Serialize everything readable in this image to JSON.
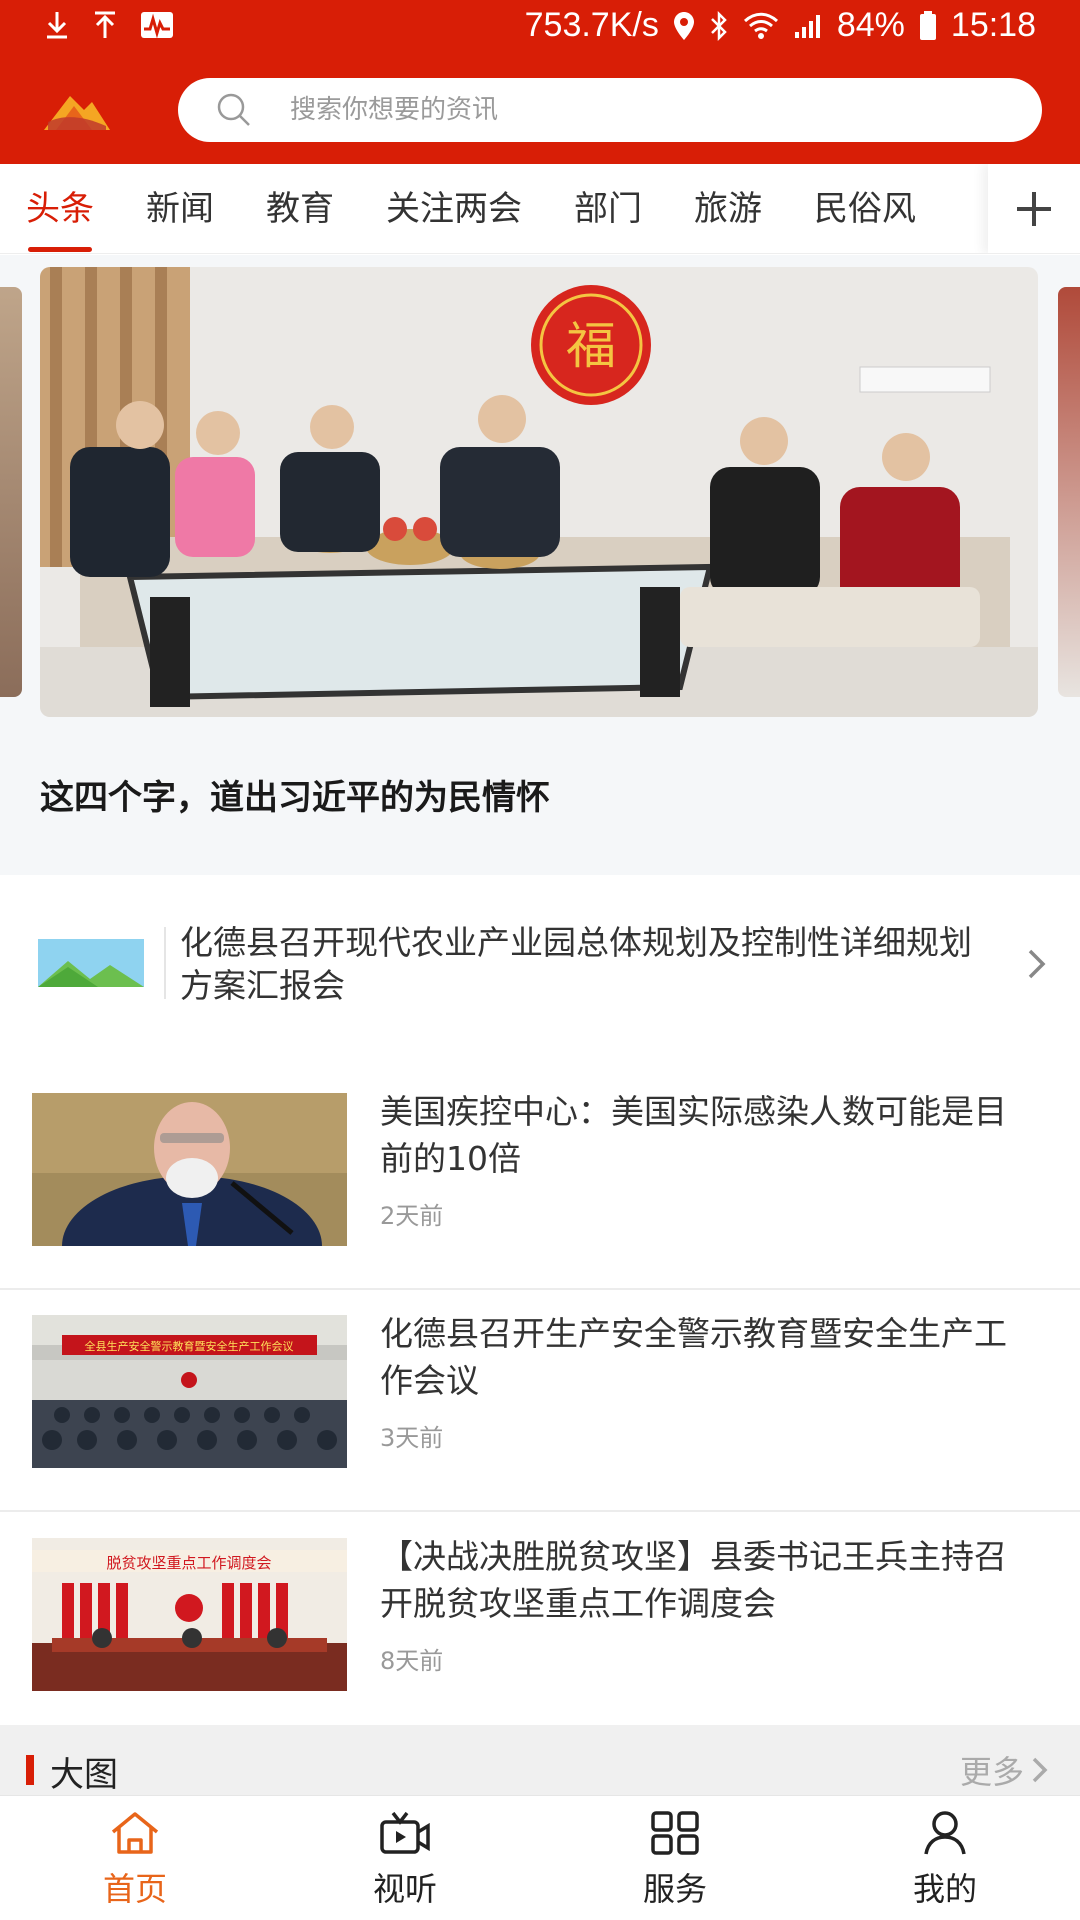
{
  "status_bar": {
    "speed": "753.7K/s",
    "battery": "84%",
    "time": "15:18"
  },
  "search": {
    "placeholder": "搜索你想要的资讯"
  },
  "tabs": [
    {
      "label": "头条",
      "active": true
    },
    {
      "label": "新闻"
    },
    {
      "label": "教育"
    },
    {
      "label": "关注两会"
    },
    {
      "label": "部门"
    },
    {
      "label": "旅游"
    },
    {
      "label": "民俗风"
    }
  ],
  "banner": {
    "title": "这四个字，道出习近平的为民情怀",
    "image_text": "福"
  },
  "text_news": {
    "title": "化德县召开现代农业产业园总体规划及控制性详细规划方案汇报会"
  },
  "news": [
    {
      "title": "美国疾控中心：美国实际感染人数可能是目前的10倍",
      "time": "2天前"
    },
    {
      "title": "化德县召开生产安全警示教育暨安全生产工作会议",
      "time": "3天前",
      "image_text": "全县生产安全警示教育暨安全生产工作会议"
    },
    {
      "title": "【决战决胜脱贫攻坚】县委书记王兵主持召开脱贫攻坚重点工作调度会",
      "time": "8天前",
      "image_text": "脱贫攻坚重点工作调度会"
    }
  ],
  "section": {
    "label": "大图",
    "more": "更多"
  },
  "bottom_nav": [
    {
      "label": "首页",
      "icon": "home-icon",
      "active": true
    },
    {
      "label": "视听",
      "icon": "video-icon"
    },
    {
      "label": "服务",
      "icon": "grid-icon"
    },
    {
      "label": "我的",
      "icon": "user-icon"
    }
  ],
  "colors": {
    "brand_red": "#d81e06",
    "nav_active": "#e8651a"
  }
}
